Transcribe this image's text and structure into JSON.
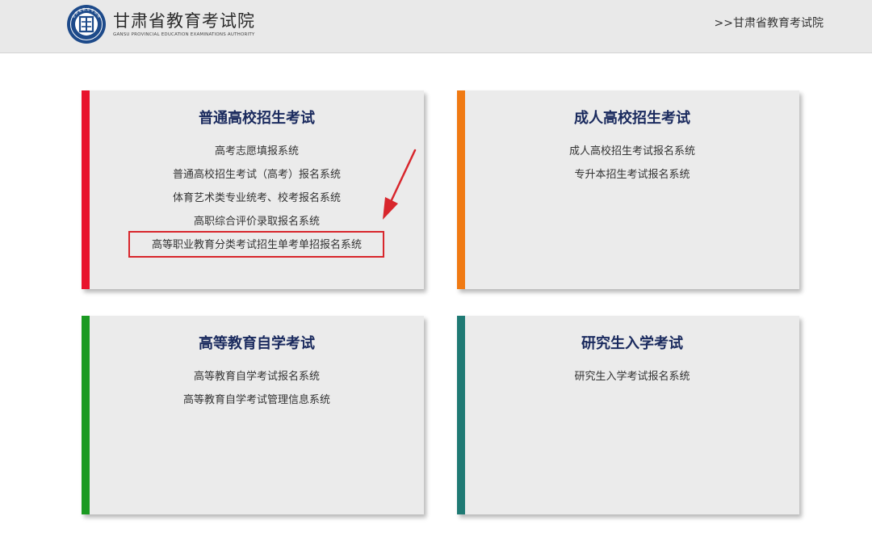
{
  "header": {
    "site_title": "甘肃省教育考试院",
    "site_subtitle_en": "GANSU PROVINCIAL EDUCATION EXAMINATIONS AUTHORITY",
    "emblem_text": "甘肃省教育考试院",
    "breadcrumb_link": ">>甘肃省教育考试院",
    "background": "#e9e9e9"
  },
  "cards": [
    {
      "title": "普通高校招生考试",
      "accent": "#e8132d",
      "links": [
        "高考志愿填报系统",
        "普通高校招生考试（高考）报名系统",
        "体育艺术类专业统考、校考报名系统",
        "高职综合评价录取报名系统",
        "高等职业教育分类考试招生单考单招报名系统"
      ],
      "highlighted_link": "高等职业教育分类考试招生单考单招报名系统"
    },
    {
      "title": "成人高校招生考试",
      "accent": "#f07a13",
      "links": [
        "成人高校招生考试报名系统",
        "专升本招生考试报名系统"
      ]
    },
    {
      "title": "高等教育自学考试",
      "accent": "#1b9a22",
      "links": [
        "高等教育自学考试报名系统",
        "高等教育自学考试管理信息系统"
      ]
    },
    {
      "title": "研究生入学考试",
      "accent": "#1f7a74",
      "links": [
        "研究生入学考试报名系统"
      ]
    }
  ],
  "colors": {
    "title_text": "#1a2a5e",
    "card_bg": "#ebebeb",
    "annotation": "#d8262c"
  }
}
